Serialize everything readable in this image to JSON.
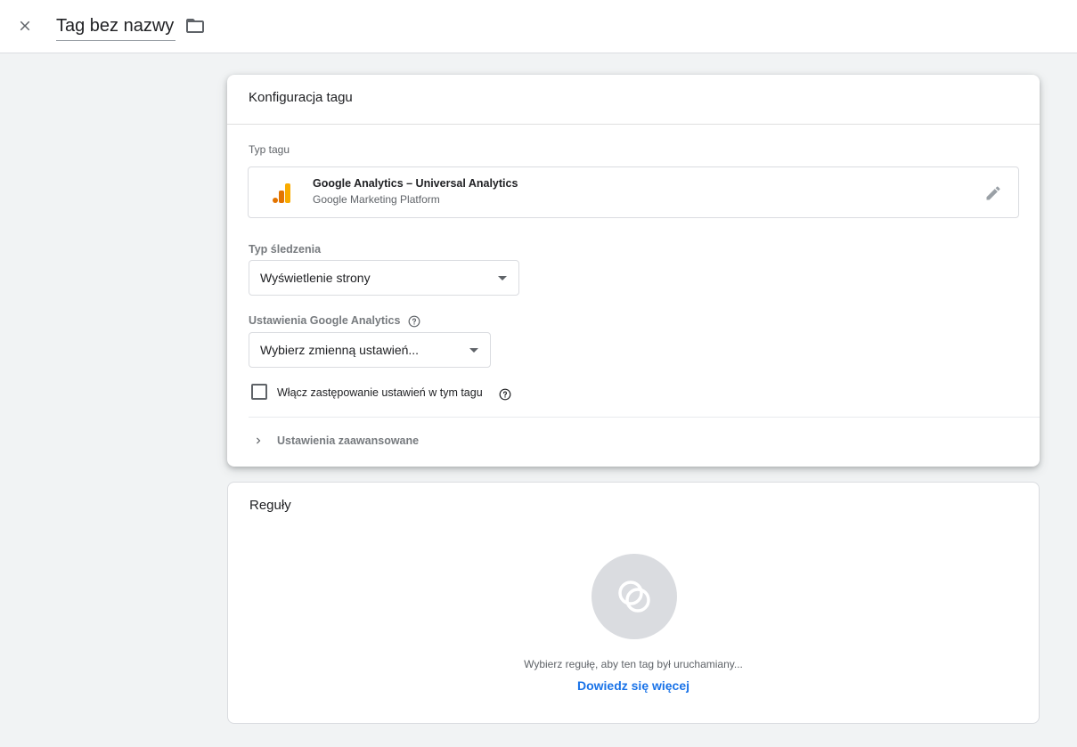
{
  "header": {
    "tag_name": "Tag bez nazwy"
  },
  "config": {
    "title": "Konfiguracja tagu",
    "tag_type_label": "Typ tagu",
    "tag_type": {
      "name": "Google Analytics – Universal Analytics",
      "platform": "Google Marketing Platform"
    },
    "tracking_type_label": "Typ śledzenia",
    "tracking_type_value": "Wyświetlenie strony",
    "ga_settings_label": "Ustawienia Google Analytics",
    "ga_settings_value": "Wybierz zmienną ustawień...",
    "override_label": "Włącz zastępowanie ustawień w tym tagu",
    "override_checked": false,
    "advanced_label": "Ustawienia zaawansowane"
  },
  "rules": {
    "title": "Reguły",
    "empty_text": "Wybierz regułę, aby ten tag był uruchamiany...",
    "learn_more": "Dowiedz się więcej"
  },
  "colors": {
    "ga_logo_dark": "#e37400",
    "ga_logo_light": "#f9ab00",
    "link": "#1a73e8"
  },
  "icons": [
    "close-icon",
    "folder-icon",
    "google-analytics-logo",
    "pencil-icon",
    "help-circle-icon",
    "chevron-right-icon",
    "trigger-icon"
  ]
}
